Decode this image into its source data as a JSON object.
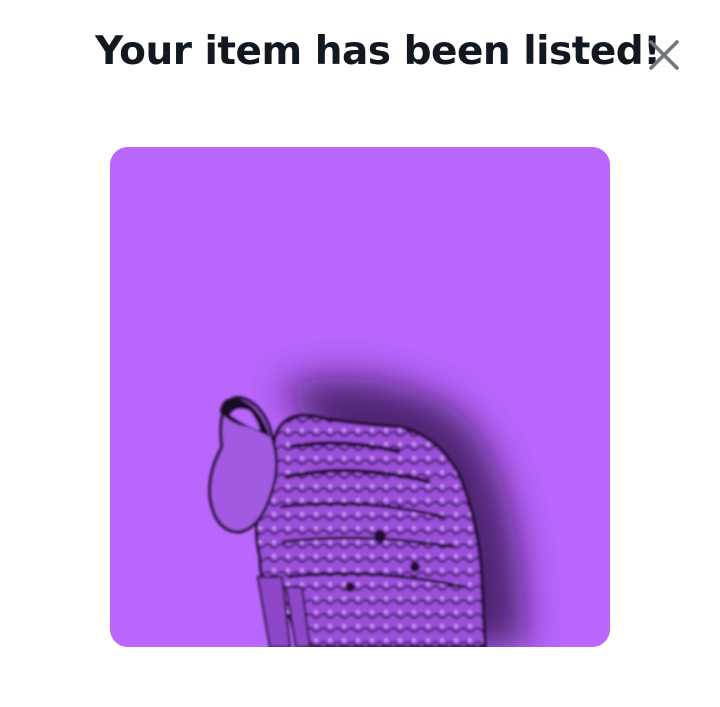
{
  "dialog": {
    "title": "Your item has been listed!",
    "close_icon": "close-icon",
    "close_color": "#71767a",
    "title_color": "#111820"
  },
  "listing_image": {
    "subject": "cat",
    "background_color": "#b866fb",
    "shadow_color": "#2b0f44"
  }
}
